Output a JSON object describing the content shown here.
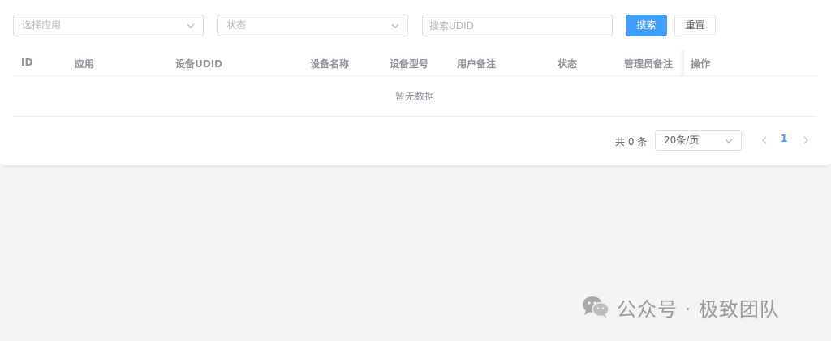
{
  "filters": {
    "app_placeholder": "选择应用",
    "status_placeholder": "状态",
    "udid_placeholder": "搜索UDID",
    "search_label": "搜索",
    "reset_label": "重置"
  },
  "table": {
    "columns": [
      "ID",
      "应用",
      "设备UDID",
      "设备名称",
      "设备型号",
      "用户备注",
      "状态",
      "管理员备注",
      "操作"
    ],
    "empty_text": "暂无数据"
  },
  "pagination": {
    "total_text": "共 0 条",
    "page_size": "20条/页",
    "current_page": "1"
  },
  "watermark": {
    "text": "公众号 · 极致团队"
  },
  "colors": {
    "primary": "#409eff",
    "background": "#f3f3f3"
  }
}
